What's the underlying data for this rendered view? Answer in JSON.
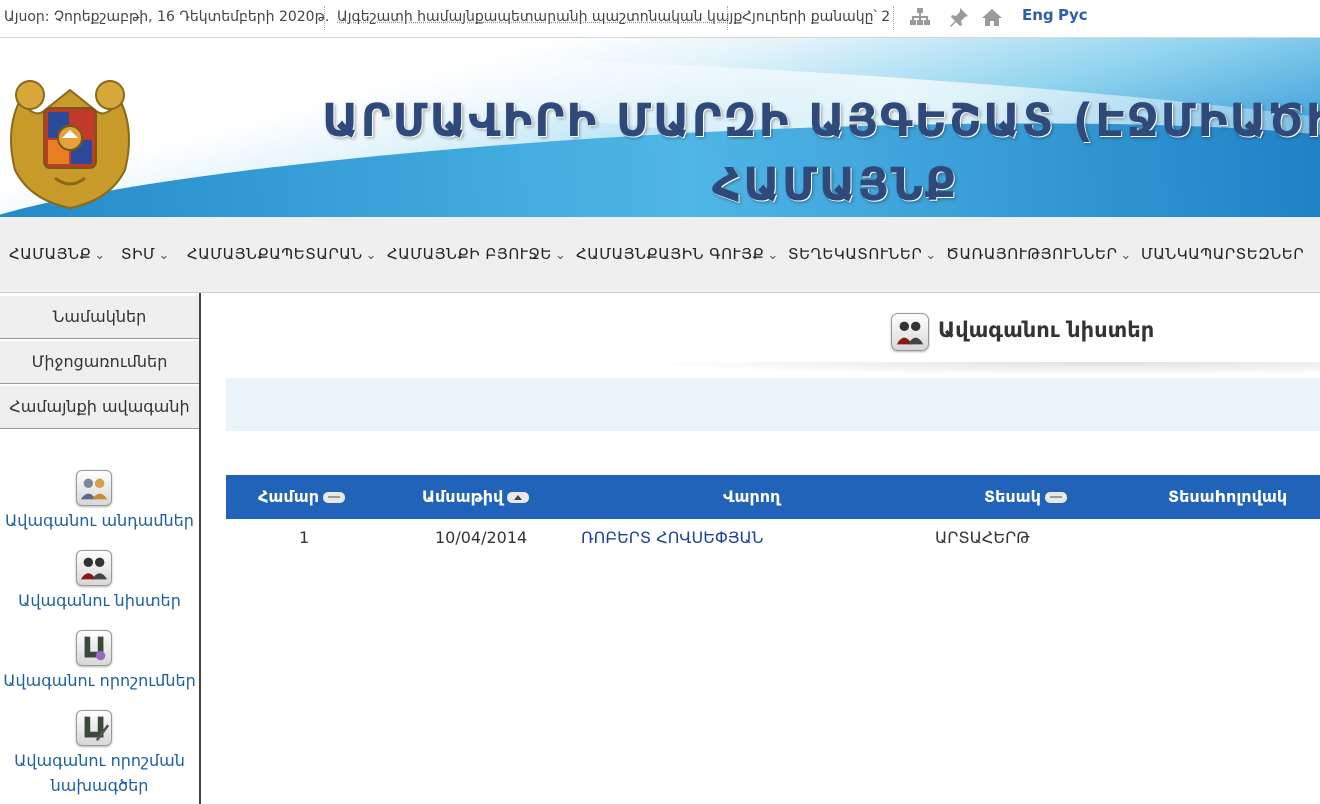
{
  "topbar": {
    "date": "Այսօր: Չորեքշաբթի, 16 Դեկտեմբերի 2020թ.",
    "official_site": "Այգեշատի համայնքապետարանի պաշտոնական կայք",
    "visitors": "Հյուրերի քանակը՝ 2",
    "icons": [
      "sitemap-icon",
      "pin-icon",
      "home-icon"
    ],
    "lang_en": "Eng",
    "lang_ru": "Рус"
  },
  "banner": {
    "title_line1": "ԱՐՄԱՎԻՐԻ ՄԱՐԶԻ ԱՅԳԵՇԱՏ (ԷՋՄԻԱԾԻՆ",
    "title_line2": "ՀԱՄԱՅՆՔ"
  },
  "nav": [
    {
      "label": "ՀԱՄԱՅՆՔ"
    },
    {
      "label": "ՏԻՄ"
    },
    {
      "label": "ՀԱՄԱՅՆՔԱՊԵՏԱՐԱՆ"
    },
    {
      "label": "ՀԱՄԱՅՆՔԻ ԲՅՈՒՋԵ"
    },
    {
      "label": "ՀԱՄԱՅՆՔԱՅԻՆ ԳՈՒՅՔ"
    },
    {
      "label": "ՏԵՂԵԿԱՏՈՒՆԵՐ"
    },
    {
      "label": "ԾԱՌԱՅՈՒԹՅՈՒՆՆԵՐ"
    },
    {
      "label": "ՄԱՆԿԱՊԱՐՏԵԶՆԵՐ"
    }
  ],
  "nav_chevron": "⌄",
  "sidebar": {
    "buttons": [
      "Նամակներ",
      "Միջոցառումներ",
      "Համայնքի ավագանի"
    ],
    "links": [
      {
        "label": "Ավագանու անդամներ",
        "icon": "members-icon"
      },
      {
        "label": "Ավագանու նիստեր",
        "icon": "sessions-icon"
      },
      {
        "label": "Ավագանու որոշումներ",
        "icon": "decisions-icon"
      },
      {
        "label_line1": "Ավագանու որոշման",
        "label_line2": "նախագծեր",
        "icon": "draft-decisions-icon"
      }
    ]
  },
  "content": {
    "heading": "Ավագանու նիստեր",
    "table": {
      "columns": [
        "Համար",
        "Ամսաթիվ",
        "Վարող",
        "Տեսակ",
        "Տեսաhոլովակ"
      ],
      "rows": [
        {
          "number": "1",
          "date": "10/04/2014",
          "chair": "ՌՈԲԵՐՏ ՀՈՎՍԵՓՅԱՆ",
          "type": "ԱՐՏԱՀԵՐԹ",
          "video": ""
        }
      ]
    }
  },
  "colors": {
    "table_header": "#2163b8",
    "link": "#1d5fa0",
    "banner_title": "#2f4a7a"
  }
}
